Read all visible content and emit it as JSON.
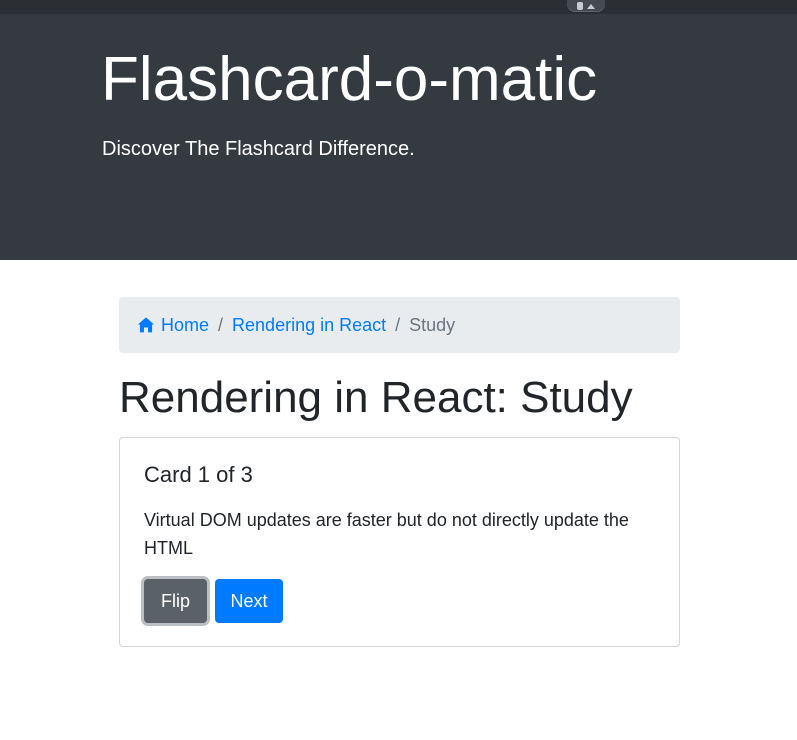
{
  "header": {
    "app_title": "Flashcard-o-matic",
    "tagline": "Discover The Flashcard Difference."
  },
  "breadcrumb": {
    "home_icon": "home-icon",
    "home_label": "Home",
    "separator": "/",
    "deck_label": "Rendering in React",
    "current_label": "Study"
  },
  "page": {
    "title": "Rendering in React: Study"
  },
  "card": {
    "counter": "Card 1 of 3",
    "text": "Virtual DOM updates are faster but do not directly update the HTML",
    "flip_label": "Flip",
    "next_label": "Next"
  },
  "colors": {
    "header_bg": "#343a40",
    "link": "#007bff",
    "breadcrumb_bg": "#e9ecef",
    "flip_button": "#5a6268",
    "next_button": "#007bff"
  }
}
